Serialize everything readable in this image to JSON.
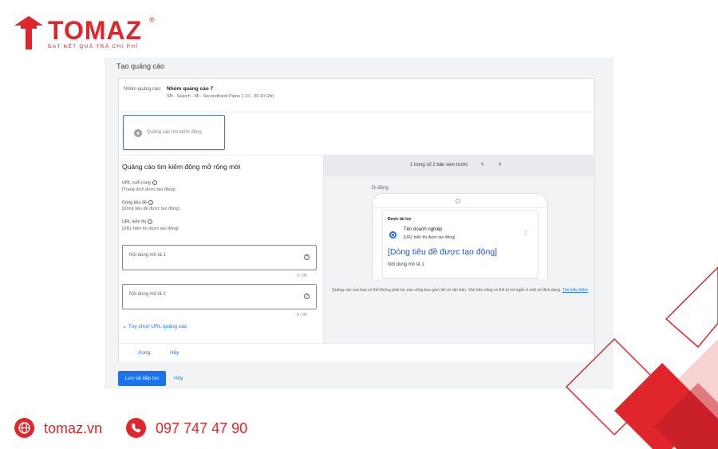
{
  "brand": {
    "name": "TOMAZ",
    "registered": "®",
    "slogan": "ĐẠT KẾT QUẢ TRẢ CHI PHÍ",
    "primary_color": "#e0262b"
  },
  "page": {
    "title": "Tạo quảng cáo"
  },
  "ad_group": {
    "label": "Nhóm quảng cáo:",
    "value": "Nhóm quảng cáo 7",
    "campaign": "SN - Search - Mi - Secondhand Piano 1.10 - 30.10 (2tr)"
  },
  "ad_type": {
    "label": "Quảng cáo tìm kiếm động",
    "icon": "plus-circle-icon"
  },
  "editor": {
    "title": "Quảng cáo tìm kiếm động mở rộng mới",
    "final_url": {
      "label": "URL cuối cùng",
      "value": "[Trang đích được tạo động]"
    },
    "headline": {
      "label": "Dòng tiêu đề",
      "value": "[Dòng tiêu đề được tạo động]"
    },
    "display_url": {
      "label": "URL hiển thị",
      "value": "[URL hiển thị được tạo động]"
    },
    "description1": {
      "placeholder": "Nội dung mô tả 1",
      "counter": "0 / 90"
    },
    "description2": {
      "placeholder": "Nội dung mô tả 2",
      "counter": "0 / 90"
    },
    "url_options": "Tùy chọn URL quảng cáo"
  },
  "preview": {
    "count_text": "1 trong số 2 bản xem trước",
    "device": "Di động",
    "sponsored": "Được tài trợ",
    "business_name": "Tên doanh nghiệp",
    "display_url": "[URL hiển thị được tạo động]",
    "headline": "[Dòng tiêu đề được tạo động]",
    "description": "Nội dung mô tả 1",
    "notice": "Quảng cáo của bạn có thể không phải lúc nào cũng bao gồm tất cả văn bản. Văn bản cũng có thể bị rút ngắn ở một số định dạng.",
    "learn_more": "Tìm hiểu thêm"
  },
  "footer": {
    "done": "Xong",
    "cancel": "Hủy",
    "save_continue": "Lưu và tiếp tục",
    "cancel_main": "Hủy"
  },
  "contact": {
    "website": "tomaz.vn",
    "phone": "097 747 47 90"
  }
}
